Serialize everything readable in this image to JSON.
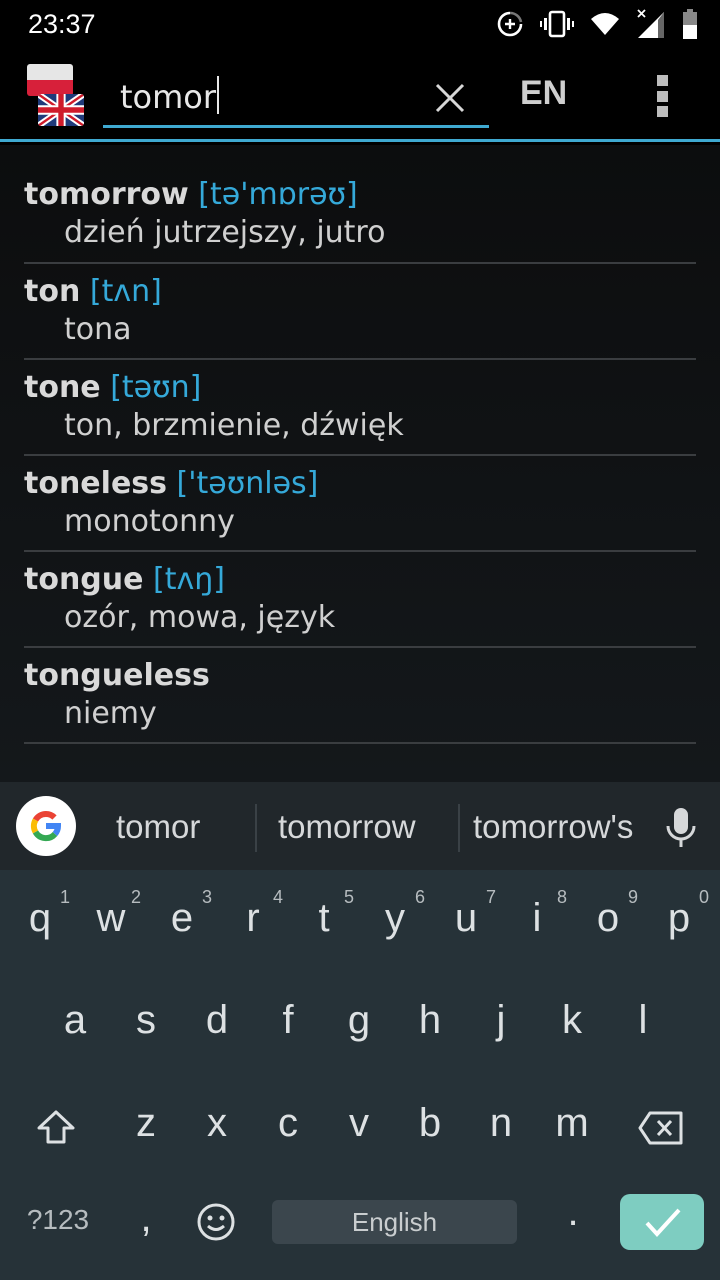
{
  "status_bar": {
    "time": "23:37",
    "icons": [
      "data-saver-icon",
      "vibrate-icon",
      "wifi-icon",
      "signal-no-data-icon",
      "battery-icon"
    ]
  },
  "toolbar": {
    "flags": {
      "source": "Polish",
      "target": "English"
    },
    "search_value": "tomor",
    "clear_icon": "close-icon",
    "language_label": "EN",
    "menu_icon": "more-vert-icon",
    "accent_color": "#3fa9d1"
  },
  "results": [
    {
      "word": "tomorrow",
      "phonetic": "[tə'mɒrəʊ]",
      "translation": "dzień jutrzejszy, jutro"
    },
    {
      "word": "ton",
      "phonetic": "[tʌn]",
      "translation": "tona"
    },
    {
      "word": "tone",
      "phonetic": "[təʊn]",
      "translation": "ton, brzmienie, dźwięk"
    },
    {
      "word": "toneless",
      "phonetic": "['təʊnləs]",
      "translation": "monotonny"
    },
    {
      "word": "tongue",
      "phonetic": "[tʌŋ]",
      "translation": "ozór, mowa, język"
    },
    {
      "word": "tongueless",
      "phonetic": "",
      "translation": "niemy"
    }
  ],
  "keyboard": {
    "suggestions": [
      "tomor",
      "tomorrow",
      "tomorrow's"
    ],
    "row1": [
      {
        "ch": "q",
        "num": "1"
      },
      {
        "ch": "w",
        "num": "2"
      },
      {
        "ch": "e",
        "num": "3"
      },
      {
        "ch": "r",
        "num": "4"
      },
      {
        "ch": "t",
        "num": "5"
      },
      {
        "ch": "y",
        "num": "6"
      },
      {
        "ch": "u",
        "num": "7"
      },
      {
        "ch": "i",
        "num": "8"
      },
      {
        "ch": "o",
        "num": "9"
      },
      {
        "ch": "p",
        "num": "0"
      }
    ],
    "row2": [
      "a",
      "s",
      "d",
      "f",
      "g",
      "h",
      "j",
      "k",
      "l"
    ],
    "row3": [
      "z",
      "x",
      "c",
      "v",
      "b",
      "n",
      "m"
    ],
    "symbols_label": "?123",
    "comma": ",",
    "space_label": "English",
    "period": ".",
    "enter_color": "#7ecdc1"
  }
}
